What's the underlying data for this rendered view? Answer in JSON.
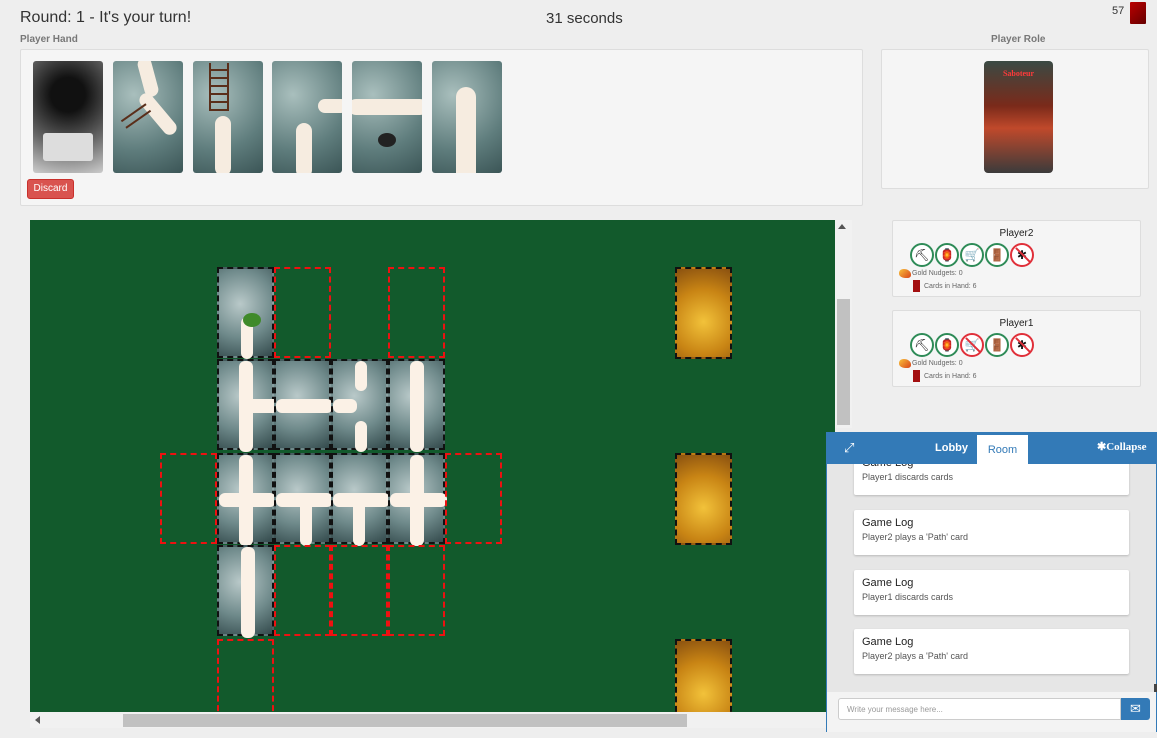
{
  "header": {
    "round_status": "Round: 1 - It's your turn!",
    "timer": "31 seconds",
    "deck_count": "57"
  },
  "hand": {
    "label": "Player Hand",
    "cards": [
      {
        "type": "action",
        "name": "map-card"
      },
      {
        "type": "path",
        "name": "path-ladder-curve"
      },
      {
        "type": "path",
        "name": "path-ladder-straight"
      },
      {
        "type": "path",
        "name": "path-bend"
      },
      {
        "type": "path",
        "name": "path-horizontal"
      },
      {
        "type": "path",
        "name": "path-dead-end"
      }
    ],
    "discard_label": "Discard"
  },
  "role": {
    "label": "Player Role",
    "card_title": "Saboteur"
  },
  "players": [
    {
      "name": "Player2",
      "tools": [
        {
          "icon": "pickaxe",
          "glyph": "⛏",
          "ok": true
        },
        {
          "icon": "lantern",
          "glyph": "🏮",
          "ok": true
        },
        {
          "icon": "minecart",
          "glyph": "🛒",
          "ok": true
        },
        {
          "icon": "door",
          "glyph": "🚪",
          "ok": true
        },
        {
          "icon": "thief",
          "glyph": "✱",
          "ok": false
        }
      ],
      "gold": "Gold Nudgets: 0",
      "cards": "Cards in Hand: 6"
    },
    {
      "name": "Player1",
      "tools": [
        {
          "icon": "pickaxe",
          "glyph": "⛏",
          "ok": true
        },
        {
          "icon": "lantern",
          "glyph": "🏮",
          "ok": true
        },
        {
          "icon": "minecart",
          "glyph": "🛒",
          "ok": false
        },
        {
          "icon": "door",
          "glyph": "🚪",
          "ok": true
        },
        {
          "icon": "thief",
          "glyph": "✱",
          "ok": false
        }
      ],
      "gold": "Gold Nudgets: 0",
      "cards": "Cards in Hand: 6"
    }
  ],
  "chat": {
    "tabs": [
      "Lobby",
      "Room"
    ],
    "active_tab": "Room",
    "collapse_label": "✱Collapse",
    "log": [
      {
        "title": "Game Log",
        "text": "Player1 discards cards"
      },
      {
        "title": "Game Log",
        "text": "Player2 plays a 'Path' card"
      },
      {
        "title": "Game Log",
        "text": "Player1 discards cards"
      },
      {
        "title": "Game Log",
        "text": "Player2 plays a 'Path' card"
      }
    ],
    "input_placeholder": "Write your message here...",
    "send_icon": "✉"
  }
}
